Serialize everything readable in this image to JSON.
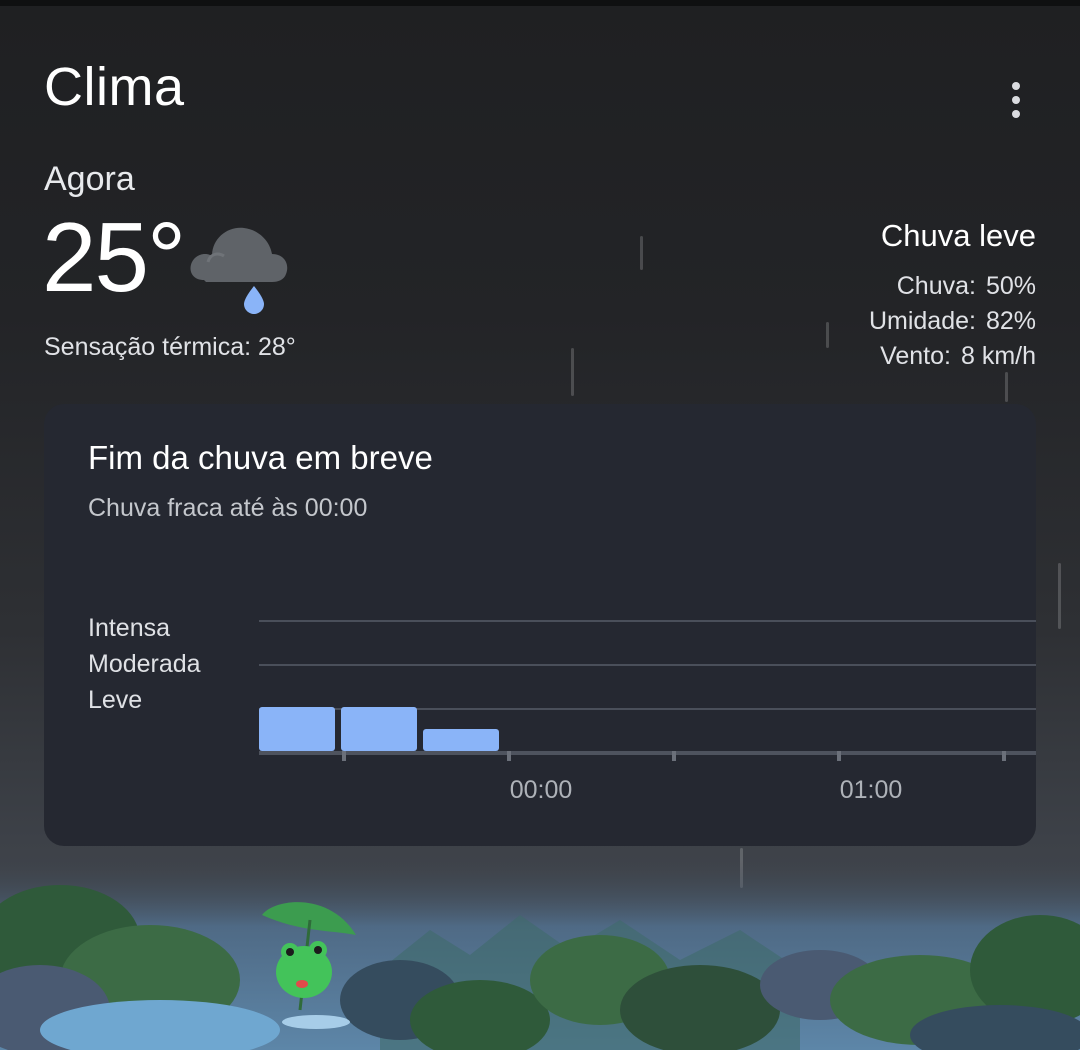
{
  "header": {
    "title": "Clima",
    "more_icon": "more-vert-icon"
  },
  "current": {
    "label": "Agora",
    "temperature": "25°",
    "condition_icon": "cloud-rain-icon",
    "feels_like": "Sensação térmica: 28°",
    "condition": "Chuva leve",
    "details": [
      {
        "label": "Chuva:",
        "value": "50%"
      },
      {
        "label": "Umidade:",
        "value": "82%"
      },
      {
        "label": "Vento:",
        "value": "8 km/h"
      }
    ]
  },
  "precip_card": {
    "title": "Fim da chuva em breve",
    "subtitle": "Chuva fraca até às 00:00",
    "levels": [
      "Intensa",
      "Moderada",
      "Leve"
    ],
    "time_labels": [
      "00:00",
      "01:00"
    ]
  },
  "chart_data": {
    "type": "bar",
    "levels": [
      "Leve",
      "Moderada",
      "Intensa"
    ],
    "bars": [
      {
        "level_fraction": 1.0
      },
      {
        "level_fraction": 1.0
      },
      {
        "level_fraction": 0.5
      }
    ],
    "x_ticks": [
      "00:00",
      "01:00"
    ],
    "bar_color": "#8ab4f8",
    "gridline_color": "#4a4f5a"
  },
  "colors": {
    "card_bg": "#252831",
    "rain_drop": "#8ab4f8",
    "cloud": "#5f6368"
  }
}
